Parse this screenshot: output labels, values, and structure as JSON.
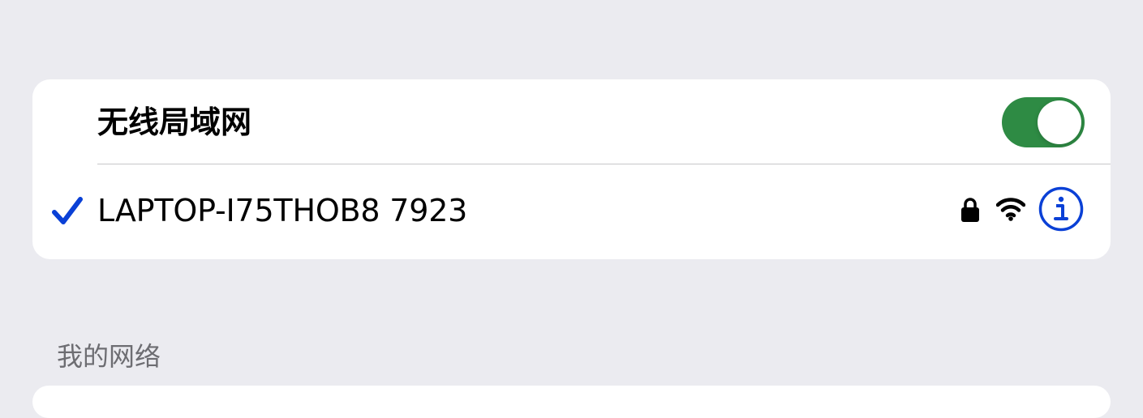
{
  "wifi_section": {
    "label": "无线局域网",
    "toggle_on": true,
    "toggle_color": "#2e8b44"
  },
  "current_network": {
    "name": "LAPTOP-I75THOB8 7923",
    "selected": true,
    "secured": true,
    "signal_icon": "wifi-full-icon",
    "accent_color": "#0a40d6"
  },
  "my_networks": {
    "header": "我的网络"
  }
}
